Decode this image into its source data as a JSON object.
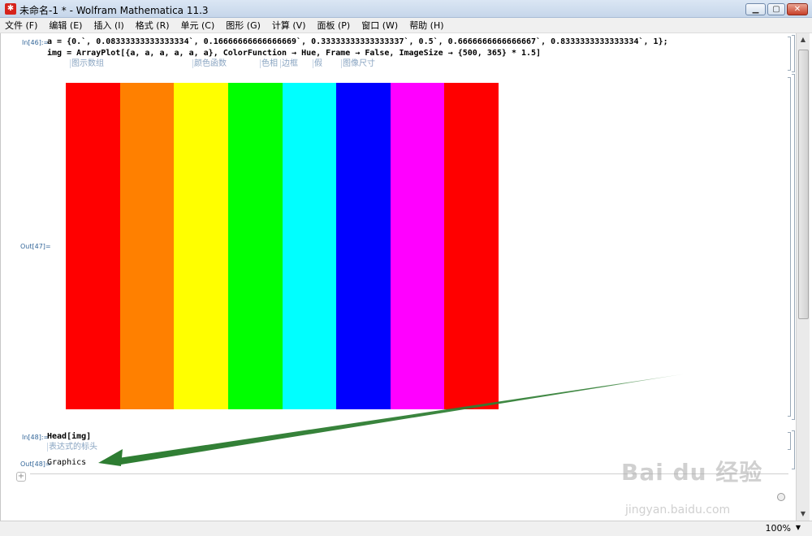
{
  "window": {
    "icon": "mathematica-icon",
    "title": "未命名-1 * - Wolfram Mathematica 11.3",
    "minimize": "▁",
    "maximize": "▢",
    "close": "✕"
  },
  "menu": [
    "文件 (F)",
    "编辑 (E)",
    "插入 (I)",
    "格式 (R)",
    "单元 (C)",
    "图形 (G)",
    "计算 (V)",
    "面板 (P)",
    "窗口 (W)",
    "帮助 (H)"
  ],
  "cells": {
    "in46_label": "In[46]:=",
    "line1": "a = {0.`, 0.08333333333333334`, 0.16666666666666669`, 0.33333333333333337`, 0.5`, 0.6666666666666667`, 0.8333333333333334`, 1};",
    "line2": "img = ArrayPlot[{a, a, a, a, a, a}, ColorFunction → Hue, Frame → False, ImageSize → {500, 365} * 1.5]",
    "hints": [
      "图示数组",
      "颜色函数",
      "色相",
      "边框",
      "假",
      "图像尺寸"
    ],
    "out47_label": "Out[47]=",
    "in48_label": "In[48]:=",
    "head_code": "Head[img]",
    "head_hint": "表达式的标头",
    "out48_label": "Out[48]=",
    "out48_value": "Graphics"
  },
  "plot": {
    "colors": [
      "#ff0000",
      "#ff8000",
      "#ffff00",
      "#00ff00",
      "#00ffff",
      "#0000ff",
      "#ff00ff",
      "#ff0000"
    ]
  },
  "status": {
    "zoom": "100%",
    "zoom_arrow": "▼"
  },
  "watermark": {
    "brand": "Bai du 经验",
    "url": "jingyan.baidu.com"
  },
  "annotation": {
    "arrow_color": "#2e7d32"
  }
}
